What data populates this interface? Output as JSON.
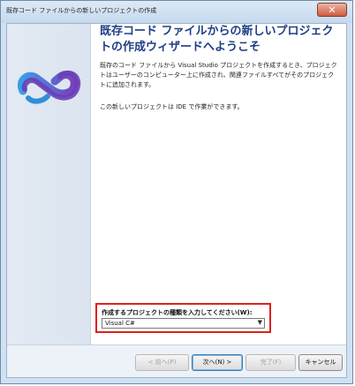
{
  "window": {
    "title": "既存コード ファイルからの新しいプロジェクトの作成",
    "close_label": "✕"
  },
  "heading": "既存コード ファイルからの新しいプロジェクトの作成ウィザードへようこそ",
  "intro_text": "既存のコード ファイルから Visual Studio プロジェクトを作成するとき、プロジェクトはユーザーのコンピューター上に作成され、関連ファイルすべてがそのプロジェクトに追加されます。",
  "ide_text": "この新しいプロジェクトは IDE で作業ができます。",
  "project_type": {
    "label": "作成するプロジェクトの種類を入力してください(W):",
    "selected": "Visual C#"
  },
  "buttons": {
    "back": "< 前へ(P)",
    "next": "次へ(N) >",
    "finish": "完了(F)",
    "cancel": "キャンセル"
  },
  "logo_icon": "visual-studio-logo-icon",
  "colors": {
    "heading": "#1e3e86",
    "highlight_frame": "#e0201b",
    "logo_purple": "#6a3fb5",
    "logo_blue": "#2f8fd8"
  }
}
